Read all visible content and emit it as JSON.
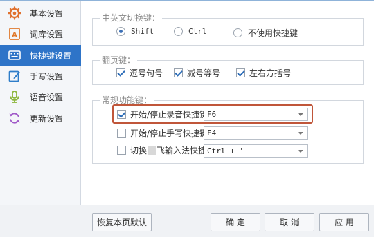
{
  "sidebar": {
    "items": [
      {
        "label": "基本设置",
        "icon": "gear-icon",
        "active": false
      },
      {
        "label": "词库设置",
        "icon": "dictionary-icon",
        "active": false
      },
      {
        "label": "快捷键设置",
        "icon": "keyboard-icon",
        "active": true
      },
      {
        "label": "手写设置",
        "icon": "handwriting-icon",
        "active": false
      },
      {
        "label": "语音设置",
        "icon": "microphone-icon",
        "active": false
      },
      {
        "label": "更新设置",
        "icon": "refresh-icon",
        "active": false
      }
    ]
  },
  "switch_group": {
    "title": "中英文切换键：",
    "options": [
      {
        "label": "Shift",
        "selected": true
      },
      {
        "label": "Ctrl",
        "selected": false
      },
      {
        "label": "不使用快捷键",
        "selected": false
      }
    ]
  },
  "paging_group": {
    "title": "翻页键：",
    "options": [
      {
        "label": "逗号句号",
        "checked": true
      },
      {
        "label": "减号等号",
        "checked": true
      },
      {
        "label": "左右方括号",
        "checked": true
      }
    ]
  },
  "common_group": {
    "title": "常规功能键：",
    "rows": [
      {
        "label": "开始/停止录音快捷键",
        "checked": true,
        "value": "F6"
      },
      {
        "label": "开始/停止手写快捷键",
        "checked": false,
        "value": "F4"
      },
      {
        "label_prefix": "切换",
        "label_suffix": "飞输入法快捷键",
        "checked": false,
        "value": "Ctrl + '"
      }
    ]
  },
  "footer": {
    "restore_label": "恢复本页默认",
    "ok_label": "确 定",
    "cancel_label": "取 消",
    "apply_label": "应 用"
  },
  "colors": {
    "accent": "#2e74c8",
    "highlight_border": "#c0563a"
  }
}
